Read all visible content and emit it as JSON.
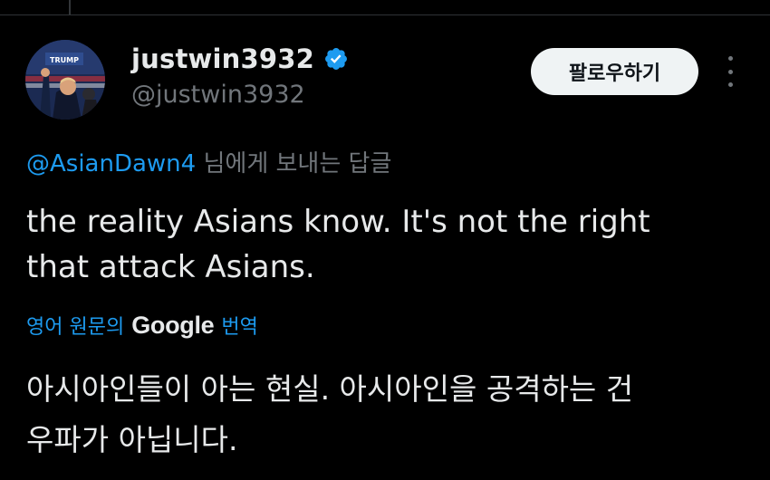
{
  "tweet": {
    "display_name": "justwin3932",
    "handle": "@justwin3932",
    "follow_label": "팔로우하기",
    "reply_mention": "@AsianDawn4",
    "reply_suffix": " 님에게 보내는 답글",
    "text_line1": "the reality Asians know. It's not the right",
    "text_line2": "that attack Asians.",
    "translate_prefix": "영어 원문의",
    "translate_brand": "Google",
    "translate_suffix": "번역",
    "translated_line1": "아시아인들이 아는 현실. 아시아인을 공격하는 건",
    "translated_line2": "우파가 아닙니다.",
    "avatar_banner_text": "TRUMP"
  },
  "icons": {
    "verified": "verified-badge-icon",
    "more": "more-options-icon"
  },
  "colors": {
    "background": "#000000",
    "text_primary": "#e7e9ea",
    "text_secondary": "#71767b",
    "accent": "#1d9bf0",
    "button_bg": "#eff3f4",
    "button_text": "#0f1419"
  }
}
